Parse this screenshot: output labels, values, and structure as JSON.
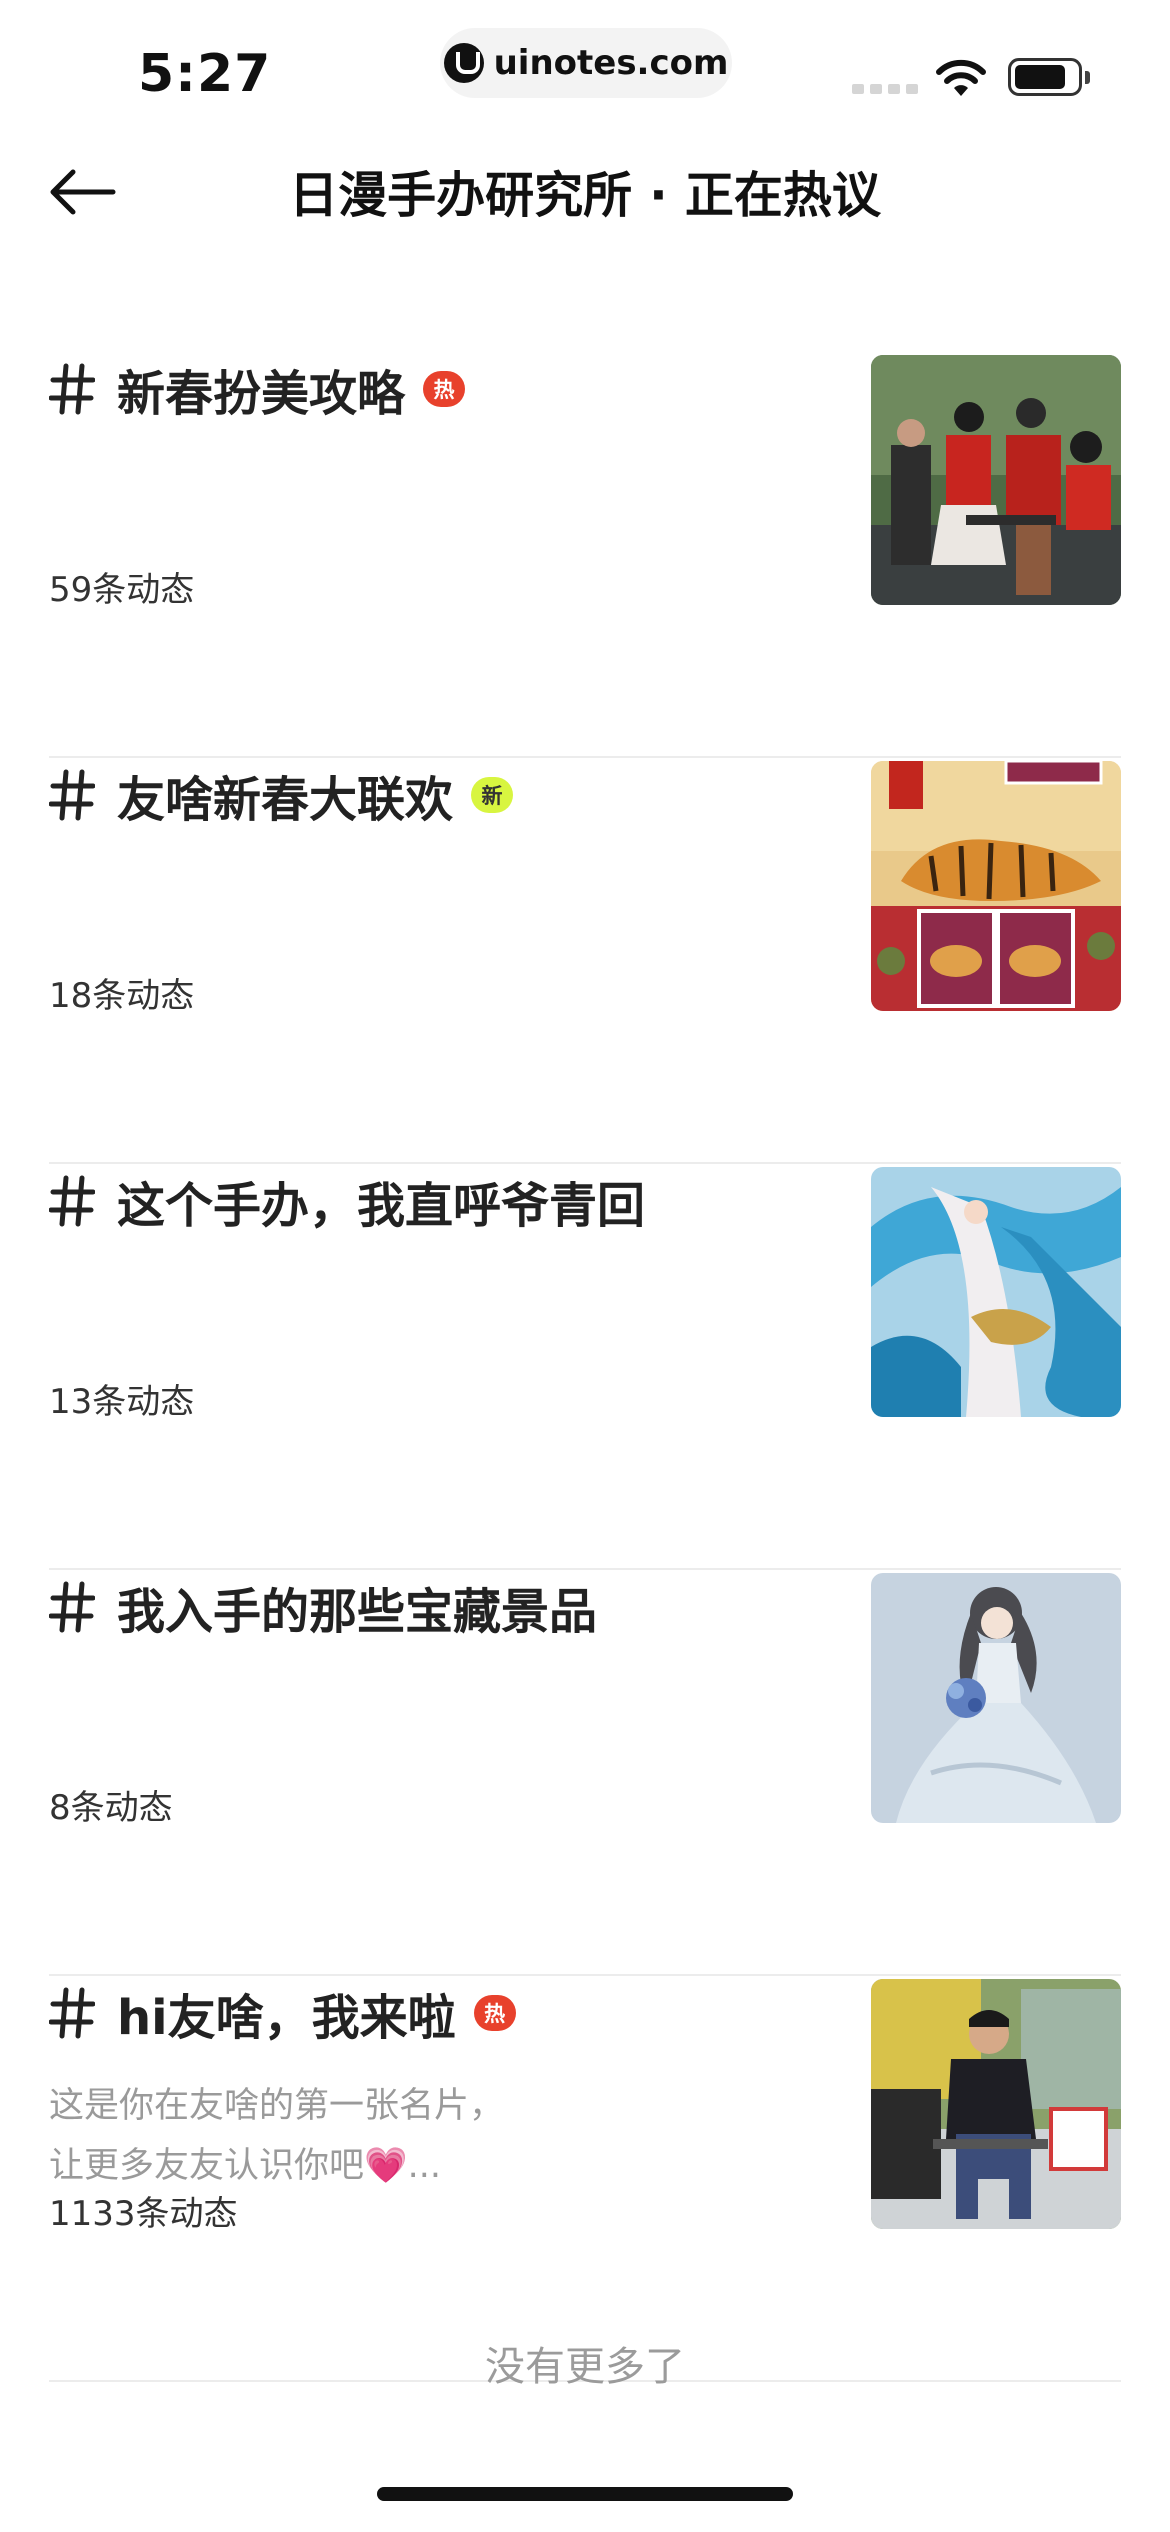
{
  "status_bar": {
    "time": "5:27",
    "url": "uinotes.com"
  },
  "header": {
    "title": "日漫手办研究所 · 正在热议"
  },
  "topics": [
    {
      "title": "新春扮美攻略",
      "badge": "热",
      "badge_type": "hot",
      "description": "",
      "count": "59条动态",
      "thumbnail": "group-photo-red-outfits"
    },
    {
      "title": "友啥新春大联欢",
      "badge": "新",
      "badge_type": "new",
      "description": "",
      "count": "18条动态",
      "thumbnail": "tiger-stamp-sheet"
    },
    {
      "title": "这个手办，我直呼爷青回",
      "badge": "",
      "badge_type": "",
      "description": "",
      "count": "13条动态",
      "thumbnail": "blue-dragon-figure"
    },
    {
      "title": "我入手的那些宝藏景品",
      "badge": "",
      "badge_type": "",
      "description": "",
      "count": "8条动态",
      "thumbnail": "bride-figure"
    },
    {
      "title": "hi友啥，我来啦",
      "badge": "热",
      "badge_type": "hot",
      "description": "这是你在友啥的第一张名片，\n让更多友友认识你吧💗...",
      "count": "1133条动态",
      "thumbnail": "man-sitting-photo"
    }
  ],
  "footer": {
    "text": "没有更多了"
  },
  "colors": {
    "hot_badge": "#e8412c",
    "new_badge": "#d8f540",
    "divider": "#ececec",
    "muted_text": "#9b9b9b"
  }
}
